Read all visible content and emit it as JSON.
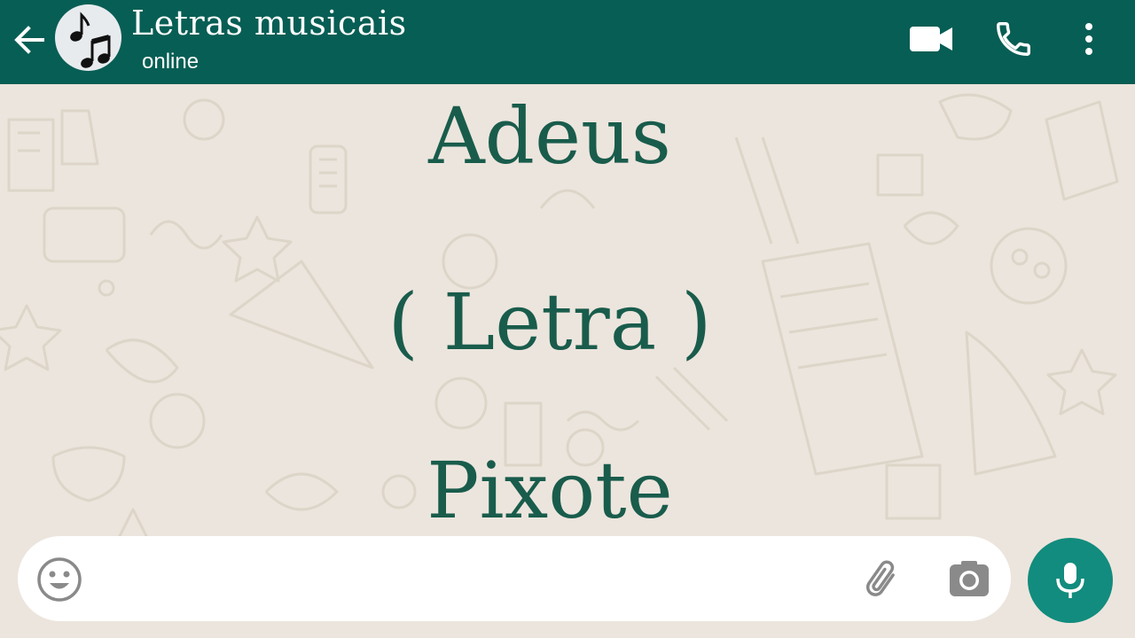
{
  "header": {
    "contact_name": "Letras musicais",
    "status": "online",
    "icons": [
      "back-arrow-icon",
      "music-notes-avatar",
      "video-call-icon",
      "phone-icon",
      "more-options-icon"
    ]
  },
  "chat": {
    "lines": [
      "Adeus",
      "( Letra )",
      "Pixote"
    ]
  },
  "input_bar": {
    "message_value": "",
    "icons": [
      "emoji-icon",
      "attach-icon",
      "camera-icon",
      "mic-icon"
    ]
  },
  "colors": {
    "header": "#075e54",
    "wallpaper": "#ece5dd",
    "lyric_text": "#195c4c",
    "mic_button": "#128c7e",
    "input_bg": "#ffffff"
  }
}
